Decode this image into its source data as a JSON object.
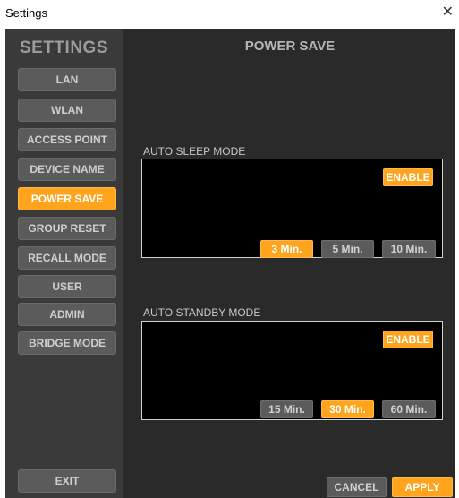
{
  "window": {
    "title": "Settings",
    "close_glyph": "✕"
  },
  "sidebar": {
    "title": "SETTINGS",
    "items": [
      {
        "label": "LAN",
        "active": false
      },
      {
        "label": "WLAN",
        "active": false
      },
      {
        "label": "ACCESS POINT",
        "active": false
      },
      {
        "label": "DEVICE NAME",
        "active": false
      },
      {
        "label": "POWER SAVE",
        "active": true
      },
      {
        "label": "GROUP RESET",
        "active": false
      },
      {
        "label": "RECALL MODE",
        "active": false
      },
      {
        "label": "USER",
        "active": false
      },
      {
        "label": "ADMIN",
        "active": false
      },
      {
        "label": "BRIDGE MODE",
        "active": false
      }
    ],
    "exit_label": "EXIT"
  },
  "main": {
    "title": "POWER SAVE",
    "auto_sleep": {
      "label": "AUTO SLEEP MODE",
      "enable_label": "ENABLE",
      "options": [
        "3 Min.",
        "5 Min.",
        "10 Min."
      ],
      "selected": "3 Min."
    },
    "auto_standby": {
      "label": "AUTO STANDBY MODE",
      "enable_label": "ENABLE",
      "options": [
        "15 Min.",
        "30 Min.",
        "60 Min."
      ],
      "selected": "30 Min."
    },
    "cancel_label": "CANCEL",
    "apply_label": "APPLY"
  },
  "colors": {
    "accent": "#ffa41c",
    "button_gray": "#5b5b5b",
    "panel": "#000000",
    "background": "#2a2a2a",
    "sidebar": "#3a3a3a"
  }
}
